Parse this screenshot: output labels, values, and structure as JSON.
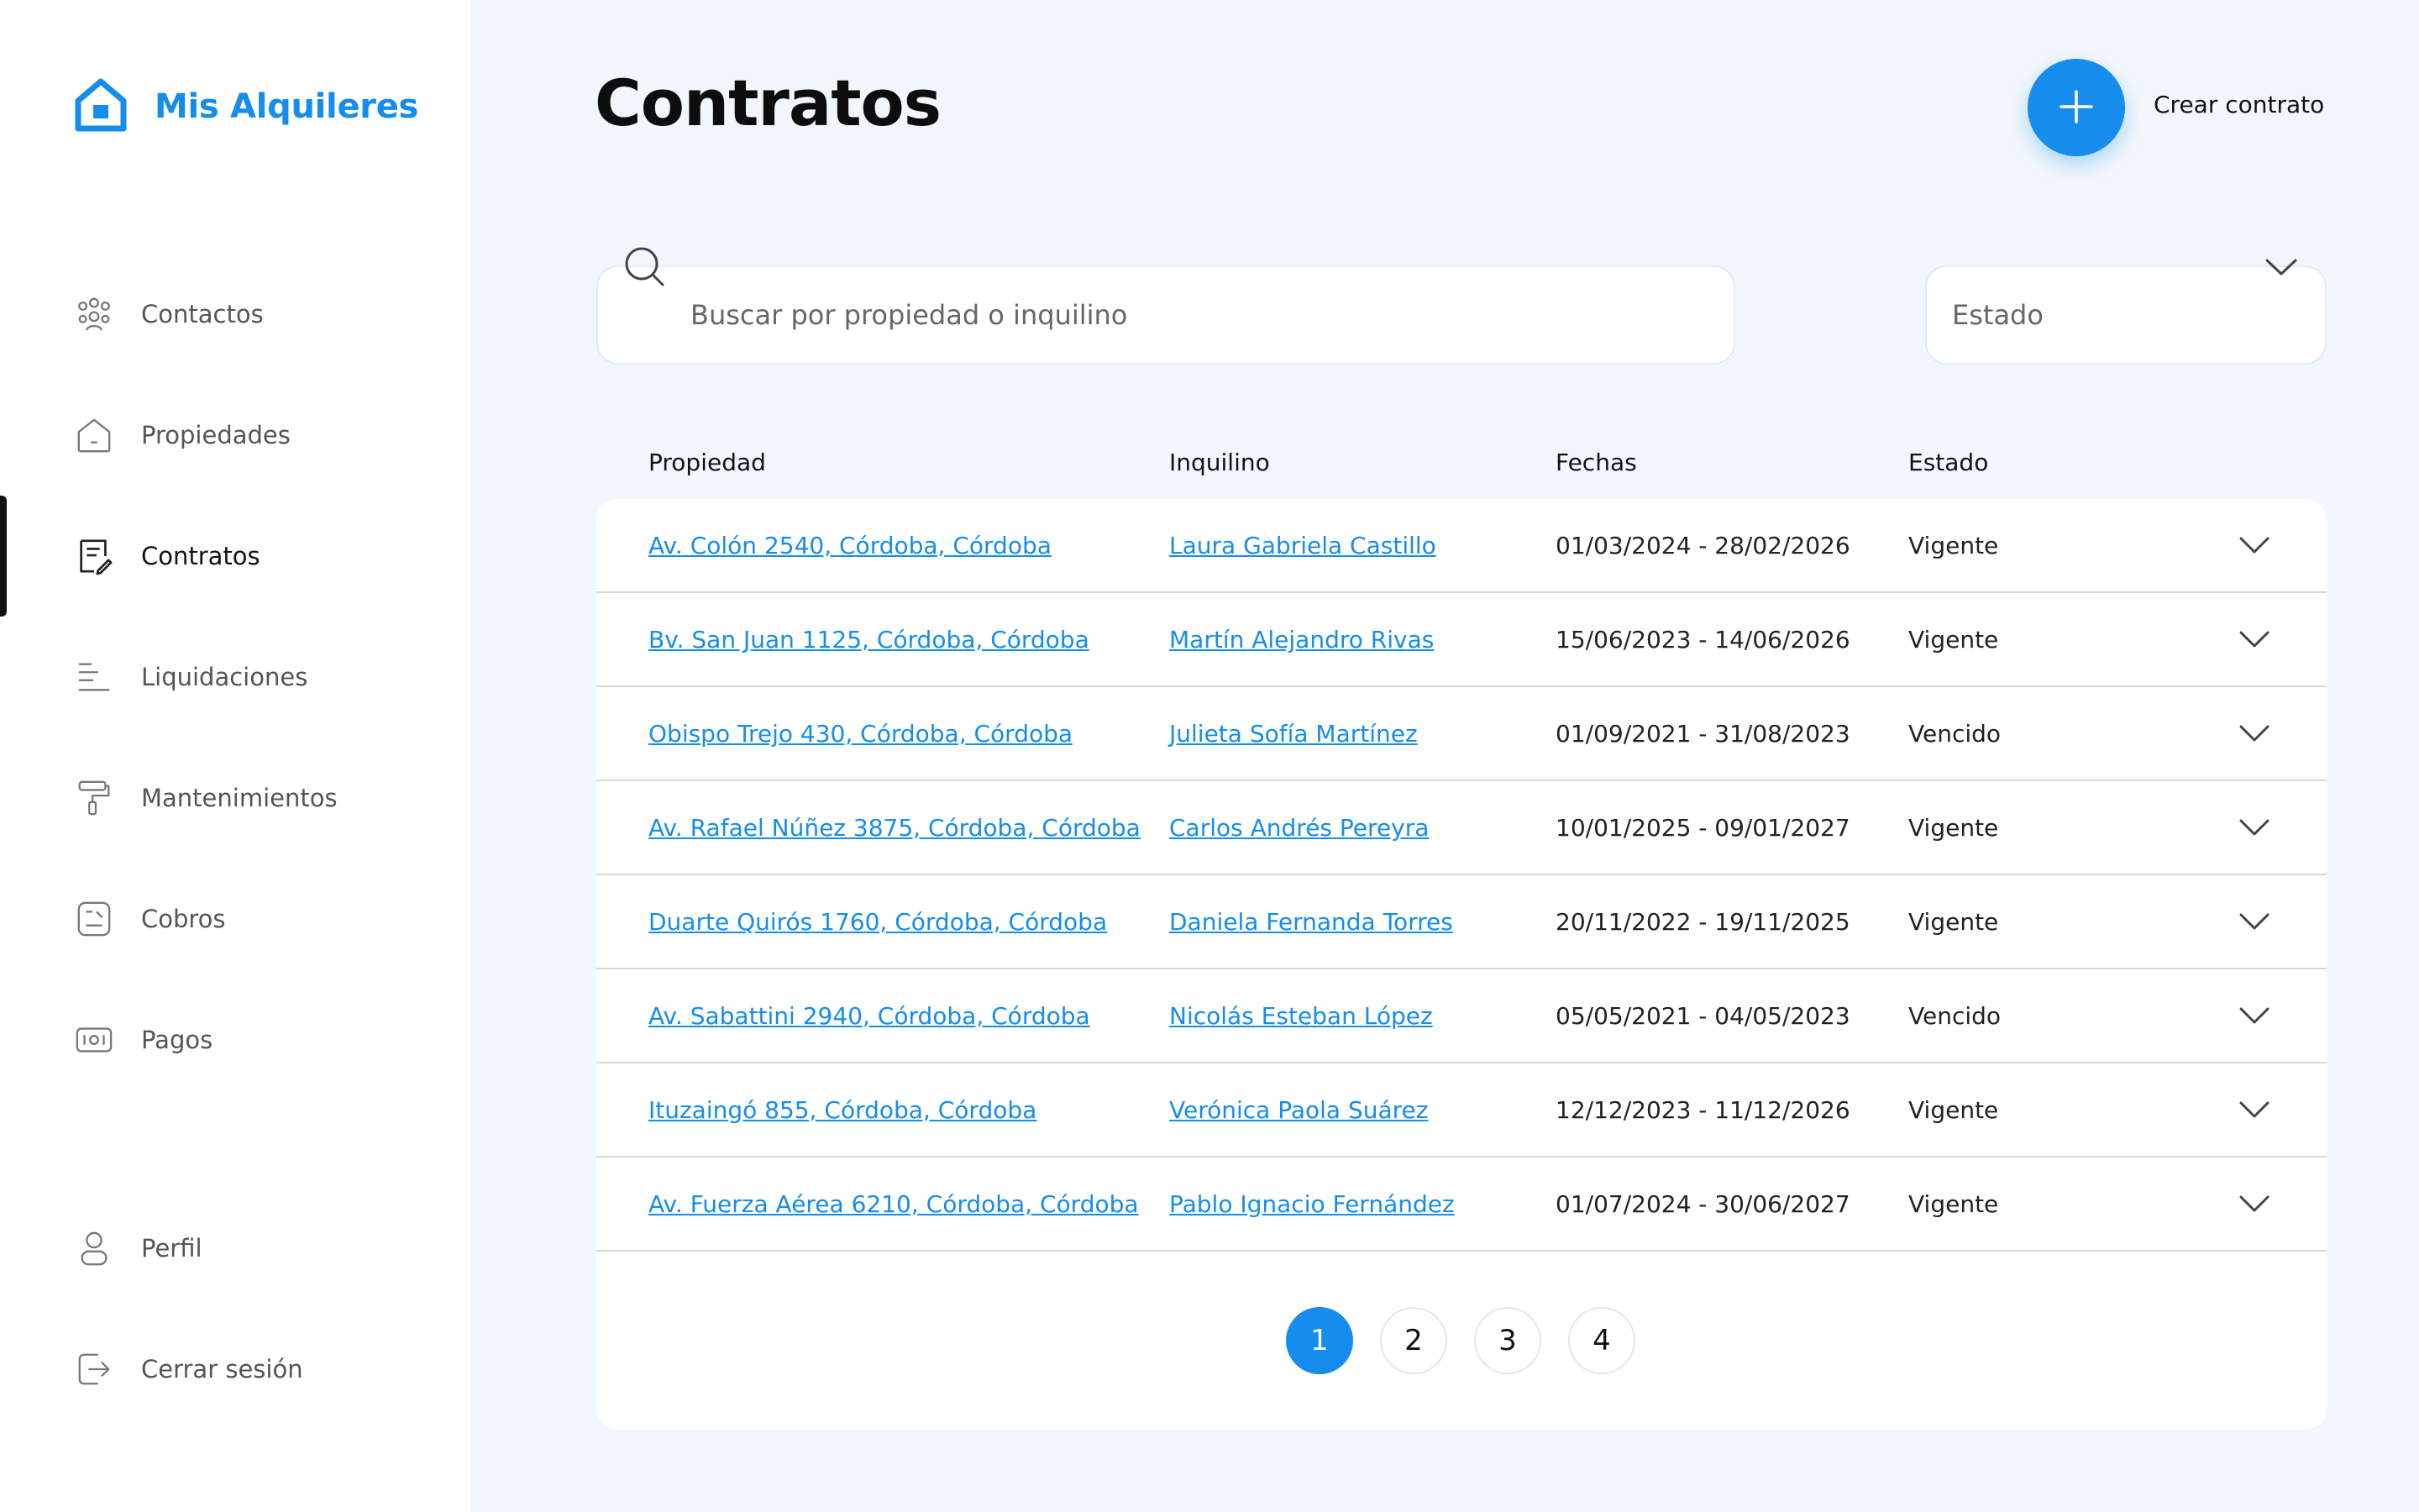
{
  "brand": {
    "name": "Mis Alquileres",
    "color": "#168cec",
    "icon": "home-icon"
  },
  "sidebar": {
    "items": [
      {
        "label": "Contactos",
        "icon": "contacts-icon",
        "active": false
      },
      {
        "label": "Propiedades",
        "icon": "house-icon",
        "active": false
      },
      {
        "label": "Contratos",
        "icon": "contract-icon",
        "active": true
      },
      {
        "label": "Liquidaciones",
        "icon": "lines-icon",
        "active": false
      },
      {
        "label": "Mantenimientos",
        "icon": "paint-roller-icon",
        "active": false
      },
      {
        "label": "Cobros",
        "icon": "receipt-icon",
        "active": false
      },
      {
        "label": "Pagos",
        "icon": "banknote-icon",
        "active": false
      }
    ],
    "footer": [
      {
        "label": "Perfil",
        "icon": "user-icon"
      },
      {
        "label": "Cerrar sesión",
        "icon": "logout-icon"
      }
    ]
  },
  "header": {
    "title": "Contratos",
    "create_label": "Crear contrato",
    "create_icon": "plus-icon"
  },
  "search": {
    "placeholder": "Buscar por propiedad o inquilino",
    "value": ""
  },
  "filter": {
    "value": "Estado"
  },
  "table": {
    "headers": [
      "Propiedad",
      "Inquilino",
      "Fechas",
      "Estado"
    ],
    "rows": [
      {
        "propiedad": "Av. Colón 2540, Córdoba, Córdoba",
        "inquilino": "Laura Gabriela Castillo",
        "fechas": "01/03/2024 - 28/02/2026",
        "estado": "Vigente"
      },
      {
        "propiedad": "Bv. San Juan 1125, Córdoba, Córdoba",
        "inquilino": "Martín Alejandro Rivas",
        "fechas": "15/06/2023 - 14/06/2026",
        "estado": "Vigente"
      },
      {
        "propiedad": "Obispo Trejo 430, Córdoba, Córdoba",
        "inquilino": "Julieta Sofía Martínez",
        "fechas": "01/09/2021 - 31/08/2023",
        "estado": "Vencido"
      },
      {
        "propiedad": "Av. Rafael Núñez 3875, Córdoba, Córdoba",
        "inquilino": "Carlos Andrés Pereyra",
        "fechas": "10/01/2025 - 09/01/2027",
        "estado": "Vigente"
      },
      {
        "propiedad": "Duarte Quirós 1760, Córdoba, Córdoba",
        "inquilino": "Daniela Fernanda Torres",
        "fechas": "20/11/2022 - 19/11/2025",
        "estado": "Vigente"
      },
      {
        "propiedad": "Av. Sabattini 2940, Córdoba, Córdoba",
        "inquilino": "Nicolás Esteban López",
        "fechas": "05/05/2021 - 04/05/2023",
        "estado": "Vencido"
      },
      {
        "propiedad": "Ituzaingó 855, Córdoba, Córdoba",
        "inquilino": "Verónica Paola Suárez",
        "fechas": "12/12/2023 - 11/12/2026",
        "estado": "Vigente"
      },
      {
        "propiedad": "Av. Fuerza Aérea 6210, Córdoba, Córdoba",
        "inquilino": "Pablo Ignacio Fernández",
        "fechas": "01/07/2024 - 30/06/2027",
        "estado": "Vigente"
      }
    ]
  },
  "pagination": {
    "pages": [
      "1",
      "2",
      "3",
      "4"
    ],
    "current": "1"
  },
  "colors": {
    "accent": "#168cec",
    "background": "#f2f7fd",
    "sidebar": "#ffffff"
  }
}
